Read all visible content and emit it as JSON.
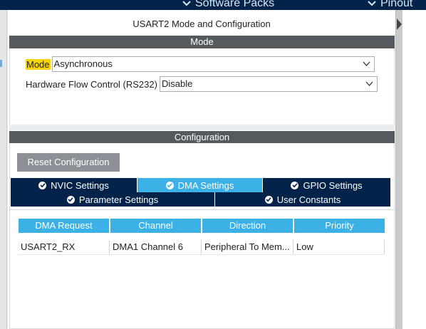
{
  "topbar": {
    "software_packs": "Software Packs",
    "pinout": "Pinout"
  },
  "panel": {
    "title": "USART2 Mode and Configuration"
  },
  "mode_section": {
    "header": "Mode",
    "mode_label": "Mode",
    "mode_value": "Asynchronous",
    "flow_label": "Hardware Flow Control (RS232)",
    "flow_value": "Disable"
  },
  "config_section": {
    "header": "Configuration",
    "reset_label": "Reset Configuration",
    "tabs": [
      {
        "label": "NVIC Settings",
        "active": false
      },
      {
        "label": "DMA Settings",
        "active": true
      },
      {
        "label": "GPIO Settings",
        "active": false
      },
      {
        "label": "Parameter Settings",
        "active": false
      },
      {
        "label": "User Constants",
        "active": false
      }
    ]
  },
  "dma_table": {
    "columns": [
      "DMA Request",
      "Channel",
      "Direction",
      "Priority"
    ],
    "rows": [
      [
        "USART2_RX",
        "DMA1 Channel 6",
        "Peripheral To Mem...",
        "Low"
      ]
    ]
  },
  "colors": {
    "navy": "#03234b",
    "accent_blue": "#3cb1e5",
    "section_gray": "#555a5f",
    "highlight_yellow": "#f7d40a"
  }
}
